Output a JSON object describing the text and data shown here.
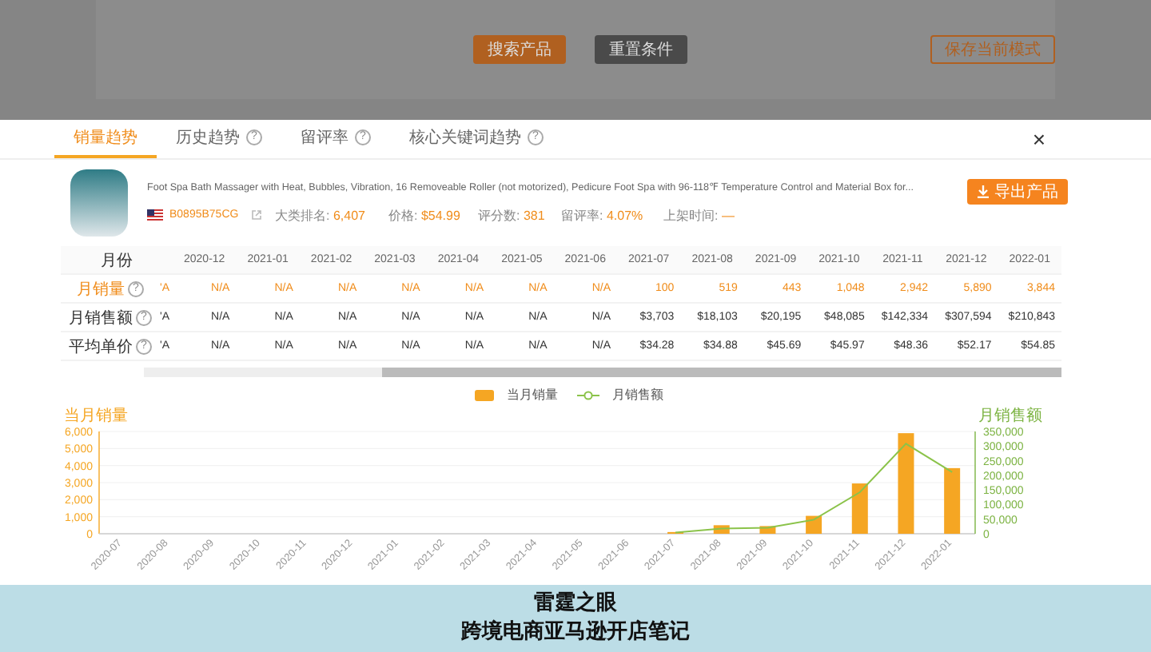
{
  "toolbar": {
    "buttons": [
      {
        "label": "搜索产品",
        "kind": "primary"
      },
      {
        "label": "重置条件",
        "kind": "dark"
      },
      {
        "label": "保存当前模式",
        "kind": "outline"
      }
    ]
  },
  "modal": {
    "tabs": [
      {
        "label": "销量趋势",
        "selected": true
      },
      {
        "label": "历史趋势",
        "help": "?",
        "selected": false
      },
      {
        "label": "留评率",
        "help": "?",
        "selected": false
      },
      {
        "label": "核心关键词趋势",
        "help": "?",
        "selected": false
      }
    ],
    "close": "×",
    "product": {
      "title": "Foot Spa Bath Massager with Heat, Bubbles, Vibration, 16 Removeable Roller (not motorized), Pedicure Foot Spa with 96-118℉ Temperature Control and Material Box for...",
      "asin": "B0895B75CG",
      "stats": [
        {
          "label": "大类排名:",
          "value": "6,407"
        },
        {
          "label": "价格:",
          "value": "$54.99"
        },
        {
          "label": "评分数:",
          "value": "381"
        },
        {
          "label": "留评率:",
          "value": "4.07%"
        },
        {
          "label": "上架时间:",
          "value": "—"
        }
      ],
      "export_button": "导出产品"
    },
    "table": {
      "header": "月份",
      "columns": [
        "2020-12",
        "2021-01",
        "2021-02",
        "2021-03",
        "2021-04",
        "2021-05",
        "2021-06",
        "2021-07",
        "2021-08",
        "2021-09",
        "2021-10",
        "2021-11",
        "2021-12",
        "2022-01"
      ],
      "rows": [
        {
          "label": "月销量",
          "help": "?",
          "cut": "'A",
          "kind": "sales",
          "cells": [
            "N/A",
            "N/A",
            "N/A",
            "N/A",
            "N/A",
            "N/A",
            "N/A",
            "100",
            "519",
            "443",
            "1,048",
            "2,942",
            "5,890",
            "3,844"
          ]
        },
        {
          "label": "月销售额",
          "help": "?",
          "cut": "'A",
          "kind": "plain",
          "cells": [
            "N/A",
            "N/A",
            "N/A",
            "N/A",
            "N/A",
            "N/A",
            "N/A",
            "$3,703",
            "$18,103",
            "$20,195",
            "$48,085",
            "$142,334",
            "$307,594",
            "$210,843"
          ]
        },
        {
          "label": "平均单价",
          "help": "?",
          "cut": "'A",
          "kind": "plain",
          "cells": [
            "N/A",
            "N/A",
            "N/A",
            "N/A",
            "N/A",
            "N/A",
            "N/A",
            "$34.28",
            "$34.88",
            "$45.69",
            "$45.97",
            "$48.36",
            "$52.17",
            "$54.85"
          ]
        }
      ]
    },
    "sales_chart": {
      "chart_data": {
        "type": "bar",
        "categories": [
          "2020-07",
          "2020-08",
          "2020-09",
          "2020-10",
          "2020-11",
          "2020-12",
          "2021-01",
          "2021-02",
          "2021-03",
          "2021-04",
          "2021-05",
          "2021-06",
          "2021-07",
          "2021-08",
          "2021-09",
          "2021-10",
          "2021-11",
          "2021-12",
          "2022-01"
        ],
        "ylabel": "当月销量",
        "ylim": [
          0,
          6000
        ],
        "grid": true,
        "yticks": [
          {
            "value": 0,
            "label": "0"
          },
          {
            "value": 1000,
            "label": "1,000"
          },
          {
            "value": 2000,
            "label": "2,000"
          },
          {
            "value": 3000,
            "label": "3,000"
          },
          {
            "value": 4000,
            "label": "4,000"
          },
          {
            "value": 5000,
            "label": "5,000"
          },
          {
            "value": 6000,
            "label": "6,000"
          }
        ],
        "series": [
          {
            "name": "当月销量",
            "color": "#f5a623",
            "values": [
              null,
              null,
              null,
              null,
              null,
              null,
              null,
              null,
              null,
              null,
              null,
              null,
              100,
              500,
              450,
              1050,
              2950,
              5900,
              3850
            ]
          }
        ]
      }
    },
    "revenue_chart": {
      "chart_data": {
        "type": "line",
        "ylabel": "月销售额",
        "ylim": [
          0,
          350000
        ],
        "yticks": [
          {
            "value": 0,
            "label": "0"
          },
          {
            "value": 50000,
            "label": "50,000"
          },
          {
            "value": 100000,
            "label": "100,000"
          },
          {
            "value": 150000,
            "label": "150,000"
          },
          {
            "value": 200000,
            "label": "200,000"
          },
          {
            "value": 250000,
            "label": "250,000"
          },
          {
            "value": 300000,
            "label": "300,000"
          },
          {
            "value": 350000,
            "label": "350,000"
          }
        ],
        "series": [
          {
            "name": "月销售额",
            "color": "#8bc34a",
            "values": [
              null,
              null,
              null,
              null,
              null,
              null,
              null,
              null,
              null,
              null,
              null,
              null,
              4000,
              18000,
              20000,
              48000,
              142000,
              308000,
              211000
            ]
          }
        ]
      }
    }
  },
  "banner": {
    "lines": [
      "雷霆之眼",
      "跨境电商亚马逊开店笔记"
    ]
  }
}
